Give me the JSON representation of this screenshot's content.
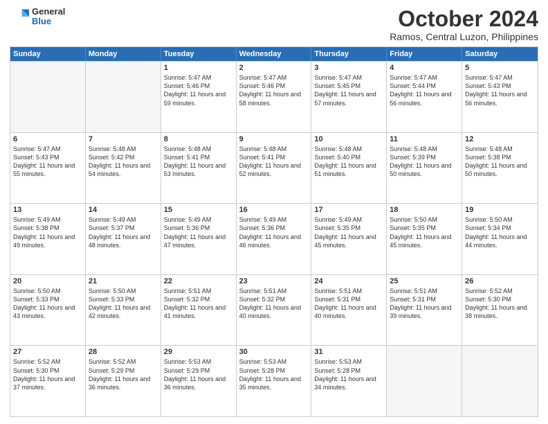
{
  "header": {
    "logo_general": "General",
    "logo_blue": "Blue",
    "month_title": "October 2024",
    "location": "Ramos, Central Luzon, Philippines"
  },
  "days_of_week": [
    "Sunday",
    "Monday",
    "Tuesday",
    "Wednesday",
    "Thursday",
    "Friday",
    "Saturday"
  ],
  "weeks": [
    [
      {
        "day": "",
        "empty": true
      },
      {
        "day": "",
        "empty": true
      },
      {
        "day": "1",
        "sunrise": "5:47 AM",
        "sunset": "5:46 PM",
        "daylight": "11 hours and 59 minutes."
      },
      {
        "day": "2",
        "sunrise": "5:47 AM",
        "sunset": "5:46 PM",
        "daylight": "11 hours and 58 minutes."
      },
      {
        "day": "3",
        "sunrise": "5:47 AM",
        "sunset": "5:45 PM",
        "daylight": "11 hours and 57 minutes."
      },
      {
        "day": "4",
        "sunrise": "5:47 AM",
        "sunset": "5:44 PM",
        "daylight": "11 hours and 56 minutes."
      },
      {
        "day": "5",
        "sunrise": "5:47 AM",
        "sunset": "5:43 PM",
        "daylight": "11 hours and 56 minutes."
      }
    ],
    [
      {
        "day": "6",
        "sunrise": "5:47 AM",
        "sunset": "5:43 PM",
        "daylight": "11 hours and 55 minutes."
      },
      {
        "day": "7",
        "sunrise": "5:48 AM",
        "sunset": "5:42 PM",
        "daylight": "11 hours and 54 minutes."
      },
      {
        "day": "8",
        "sunrise": "5:48 AM",
        "sunset": "5:41 PM",
        "daylight": "11 hours and 53 minutes."
      },
      {
        "day": "9",
        "sunrise": "5:48 AM",
        "sunset": "5:41 PM",
        "daylight": "11 hours and 52 minutes."
      },
      {
        "day": "10",
        "sunrise": "5:48 AM",
        "sunset": "5:40 PM",
        "daylight": "11 hours and 51 minutes."
      },
      {
        "day": "11",
        "sunrise": "5:48 AM",
        "sunset": "5:39 PM",
        "daylight": "11 hours and 50 minutes."
      },
      {
        "day": "12",
        "sunrise": "5:48 AM",
        "sunset": "5:38 PM",
        "daylight": "11 hours and 50 minutes."
      }
    ],
    [
      {
        "day": "13",
        "sunrise": "5:49 AM",
        "sunset": "5:38 PM",
        "daylight": "11 hours and 49 minutes."
      },
      {
        "day": "14",
        "sunrise": "5:49 AM",
        "sunset": "5:37 PM",
        "daylight": "11 hours and 48 minutes."
      },
      {
        "day": "15",
        "sunrise": "5:49 AM",
        "sunset": "5:36 PM",
        "daylight": "11 hours and 47 minutes."
      },
      {
        "day": "16",
        "sunrise": "5:49 AM",
        "sunset": "5:36 PM",
        "daylight": "11 hours and 46 minutes."
      },
      {
        "day": "17",
        "sunrise": "5:49 AM",
        "sunset": "5:35 PM",
        "daylight": "11 hours and 45 minutes."
      },
      {
        "day": "18",
        "sunrise": "5:50 AM",
        "sunset": "5:35 PM",
        "daylight": "11 hours and 45 minutes."
      },
      {
        "day": "19",
        "sunrise": "5:50 AM",
        "sunset": "5:34 PM",
        "daylight": "11 hours and 44 minutes."
      }
    ],
    [
      {
        "day": "20",
        "sunrise": "5:50 AM",
        "sunset": "5:33 PM",
        "daylight": "11 hours and 43 minutes."
      },
      {
        "day": "21",
        "sunrise": "5:50 AM",
        "sunset": "5:33 PM",
        "daylight": "11 hours and 42 minutes."
      },
      {
        "day": "22",
        "sunrise": "5:51 AM",
        "sunset": "5:32 PM",
        "daylight": "11 hours and 41 minutes."
      },
      {
        "day": "23",
        "sunrise": "5:51 AM",
        "sunset": "5:32 PM",
        "daylight": "11 hours and 40 minutes."
      },
      {
        "day": "24",
        "sunrise": "5:51 AM",
        "sunset": "5:31 PM",
        "daylight": "11 hours and 40 minutes."
      },
      {
        "day": "25",
        "sunrise": "5:51 AM",
        "sunset": "5:31 PM",
        "daylight": "11 hours and 39 minutes."
      },
      {
        "day": "26",
        "sunrise": "5:52 AM",
        "sunset": "5:30 PM",
        "daylight": "11 hours and 38 minutes."
      }
    ],
    [
      {
        "day": "27",
        "sunrise": "5:52 AM",
        "sunset": "5:30 PM",
        "daylight": "11 hours and 37 minutes."
      },
      {
        "day": "28",
        "sunrise": "5:52 AM",
        "sunset": "5:29 PM",
        "daylight": "11 hours and 36 minutes."
      },
      {
        "day": "29",
        "sunrise": "5:53 AM",
        "sunset": "5:29 PM",
        "daylight": "11 hours and 36 minutes."
      },
      {
        "day": "30",
        "sunrise": "5:53 AM",
        "sunset": "5:28 PM",
        "daylight": "11 hours and 35 minutes."
      },
      {
        "day": "31",
        "sunrise": "5:53 AM",
        "sunset": "5:28 PM",
        "daylight": "11 hours and 34 minutes."
      },
      {
        "day": "",
        "empty": true
      },
      {
        "day": "",
        "empty": true
      }
    ]
  ],
  "labels": {
    "sunrise_prefix": "Sunrise: ",
    "sunset_prefix": "Sunset: ",
    "daylight_prefix": "Daylight: "
  }
}
